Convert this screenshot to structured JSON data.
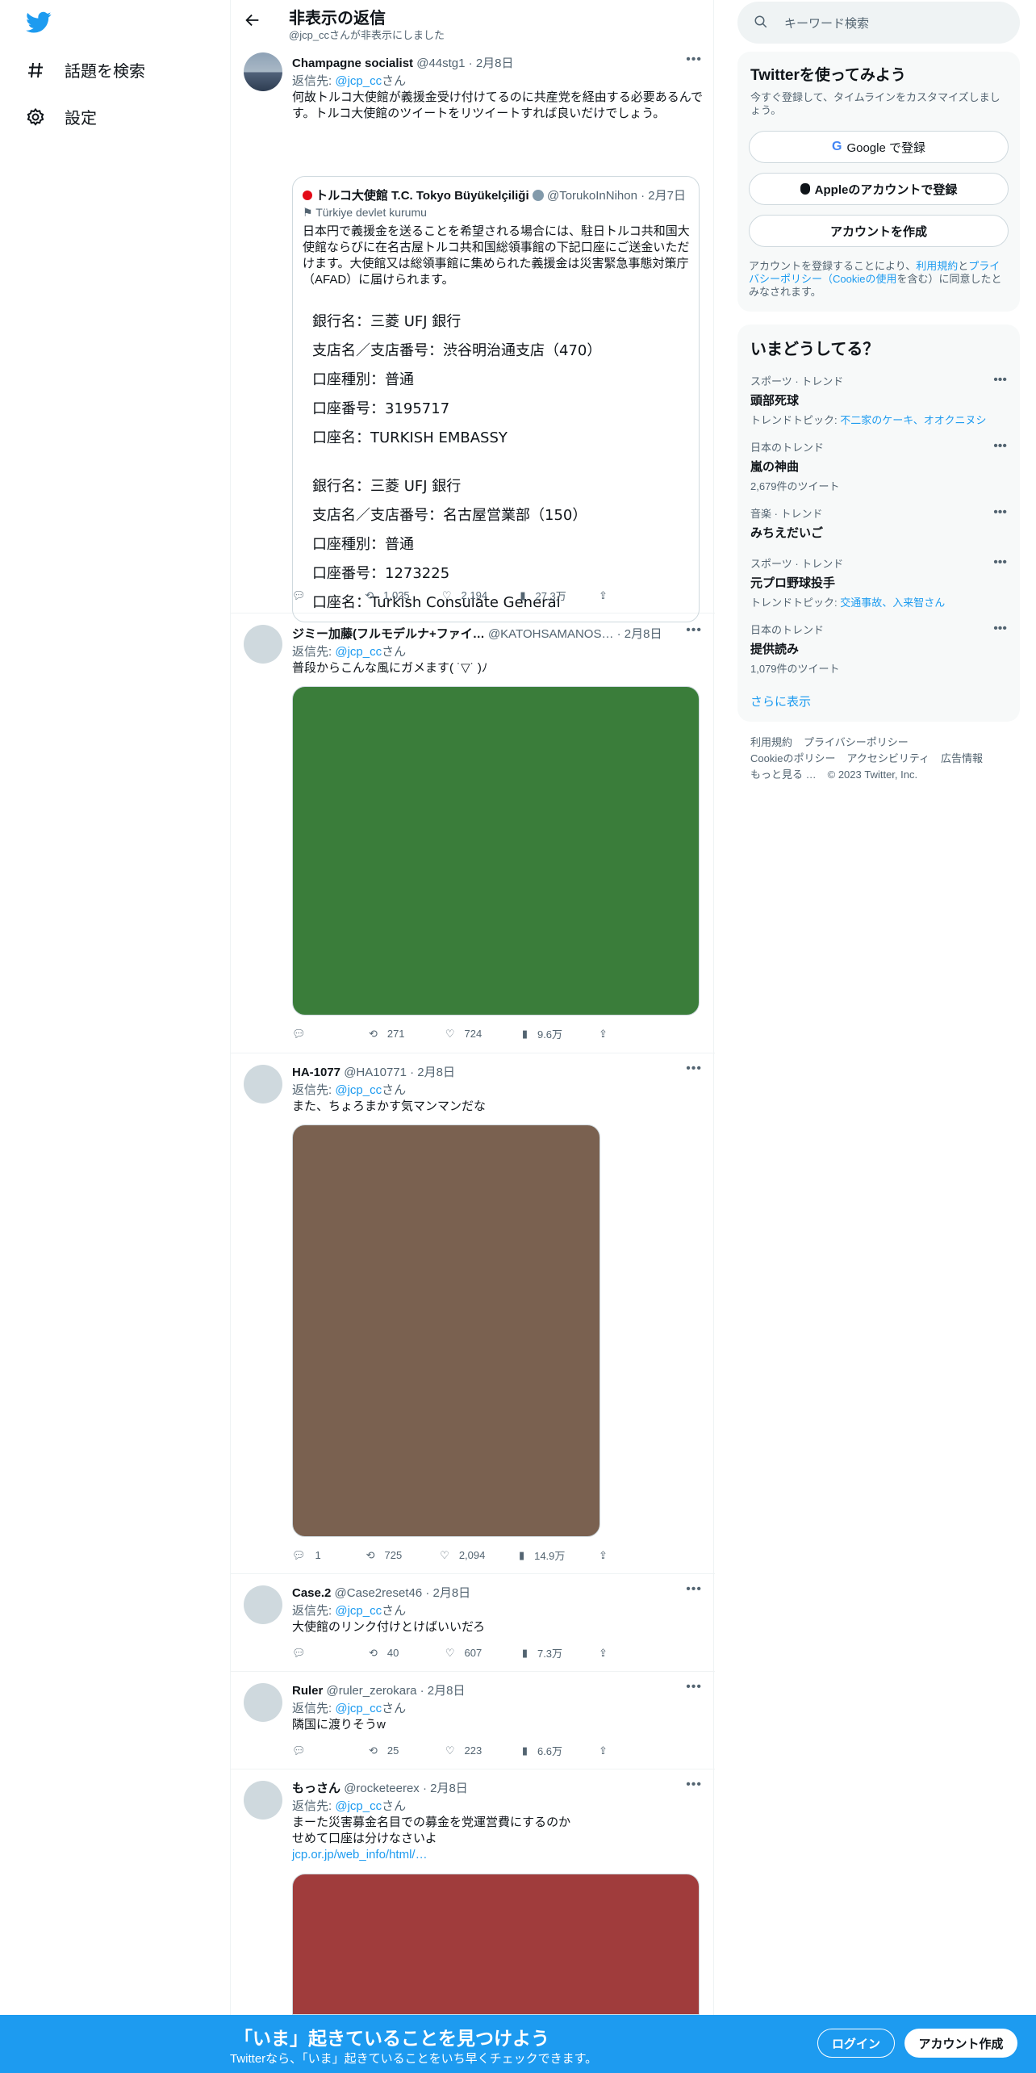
{
  "nav": {
    "explore": "話題を検索",
    "settings": "設定"
  },
  "header": {
    "title": "非表示の返信",
    "subtitle": "@jcp_ccさんが非表示にしました"
  },
  "tweets": [
    {
      "name": "Champagne socialist",
      "handle": "@44stg1 · 2月8日",
      "reply_prefix": "返信先: ",
      "reply_to": "@jcp_cc",
      "reply_suffix": "さん",
      "text": "何故トルコ大使館が義援金受け付けてるのに共産党を経由する必要あるんです。トルコ大使館のツイートをリツイートすれば良いだけでしょう。",
      "quote": {
        "name": "トルコ大使館 T.C. Tokyo Büyükelçiliği",
        "handle": "@TorukoInNihon · 2月7日",
        "affiliation": "Türkiye devlet kurumu",
        "text": "日本円で義援金を送ることを希望される場合には、駐日トルコ共和国大使館ならびに在名古屋トルコ共和国総領事館の下記口座にご送金いただけます。大使館又は総領事館に集められた義援金は災害緊急事態対策庁（AFAD）に届けられます。",
        "bank1": [
          "銀行名：三菱 UFJ 銀行",
          "支店名／支店番号：渋谷明治通支店（470）",
          "口座種別：普通",
          "口座番号：3195717",
          "口座名：TURKISH EMBASSY"
        ],
        "bank2": [
          "銀行名：三菱 UFJ 銀行",
          "支店名／支店番号：名古屋営業部（150）",
          "口座種別：普通",
          "口座番号：1273225",
          "口座名：Turkish Consulate General"
        ]
      },
      "replies": "",
      "retweets": "1,025",
      "likes": "2,194",
      "views": "27.3万"
    },
    {
      "name": "ジミー加藤(フルモデルナ+ファイ…",
      "handle": "@KATOHSAMANOS… · 2月8日",
      "reply_prefix": "返信先: ",
      "reply_to": "@jcp_cc",
      "reply_suffix": "さん",
      "text": "普段からこんな風にガメます( ˙▽˙ )ﾉ",
      "replies": "",
      "retweets": "271",
      "likes": "724",
      "views": "9.6万"
    },
    {
      "name": "HA-1077",
      "handle": "@HA10771 · 2月8日",
      "reply_prefix": "返信先: ",
      "reply_to": "@jcp_cc",
      "reply_suffix": "さん",
      "text": "また、ちょろまかす気マンマンだな",
      "replies": "1",
      "retweets": "725",
      "likes": "2,094",
      "views": "14.9万"
    },
    {
      "name": "Case.2",
      "handle": "@Case2reset46 · 2月8日",
      "reply_prefix": "返信先: ",
      "reply_to": "@jcp_cc",
      "reply_suffix": "さん",
      "text": "大使館のリンク付けとけばいいだろ",
      "replies": "",
      "retweets": "40",
      "likes": "607",
      "views": "7.3万"
    },
    {
      "name": "Ruler",
      "handle": "@ruler_zerokara · 2月8日",
      "reply_prefix": "返信先: ",
      "reply_to": "@jcp_cc",
      "reply_suffix": "さん",
      "text": "隣国に渡りそうw",
      "replies": "",
      "retweets": "25",
      "likes": "223",
      "views": "6.6万"
    },
    {
      "name": "もっさん",
      "handle": "@rocketeerex · 2月8日",
      "reply_prefix": "返信先: ",
      "reply_to": "@jcp_cc",
      "reply_suffix": "さん",
      "text_line1": "まーた災害募金名目での募金を党運営費にするのか",
      "text_line2": "せめて口座は分けなさいよ",
      "link": "jcp.or.jp/web_info/html/…"
    }
  ],
  "media_colors": {
    "tweet2": "#3a7d3a",
    "tweet3": "#7a6150",
    "tweet6": "#a03c3c"
  },
  "sidebar": {
    "search_placeholder": "キーワード検索",
    "signup": {
      "title": "Twitterを使ってみよう",
      "desc": "今すぐ登録して、タイムラインをカスタマイズしましょう。",
      "google": "Google で登録",
      "apple": "Appleのアカウントで登録",
      "create": "アカウントを作成",
      "terms_1": "アカウントを登録することにより、",
      "terms_link1": "利用規約",
      "terms_2": "と",
      "terms_link2": "プライバシーポリシー（Cookieの使用",
      "terms_3": "を含む）に同意したとみなされます。"
    },
    "trends_title": "いまどうしてる？",
    "trends": [
      {
        "category": "スポーツ · トレンド",
        "name": "頭部死球",
        "sub_prefix": "トレンドトピック: ",
        "sub_link": "不二家のケーキ、オオクニヌシ",
        "sub": ""
      },
      {
        "category": "日本のトレンド",
        "name": "嵐の神曲",
        "sub_prefix": "",
        "sub_link": "",
        "sub": "2,679件のツイート"
      },
      {
        "category": "音楽 · トレンド",
        "name": "みちえだいご",
        "sub_prefix": "",
        "sub_link": "",
        "sub": ""
      },
      {
        "category": "スポーツ · トレンド",
        "name": "元プロ野球投手",
        "sub_prefix": "トレンドトピック: ",
        "sub_link": "交通事故、入来智さん",
        "sub": ""
      },
      {
        "category": "日本のトレンド",
        "name": "提供読み",
        "sub_prefix": "",
        "sub_link": "",
        "sub": "1,079件のツイート"
      }
    ],
    "show_more": "さらに表示",
    "footer": [
      "利用規約",
      "プライバシーポリシー",
      "Cookieのポリシー",
      "アクセシビリティ",
      "広告情報",
      "もっと見る …",
      "© 2023 Twitter, Inc."
    ]
  },
  "bottom_bar": {
    "title": "「いま」起きていることを見つけよう",
    "subtitle": "Twitterなら、「いま」起きていることをいち早くチェックできます。",
    "login": "ログイン",
    "signup": "アカウント作成"
  }
}
